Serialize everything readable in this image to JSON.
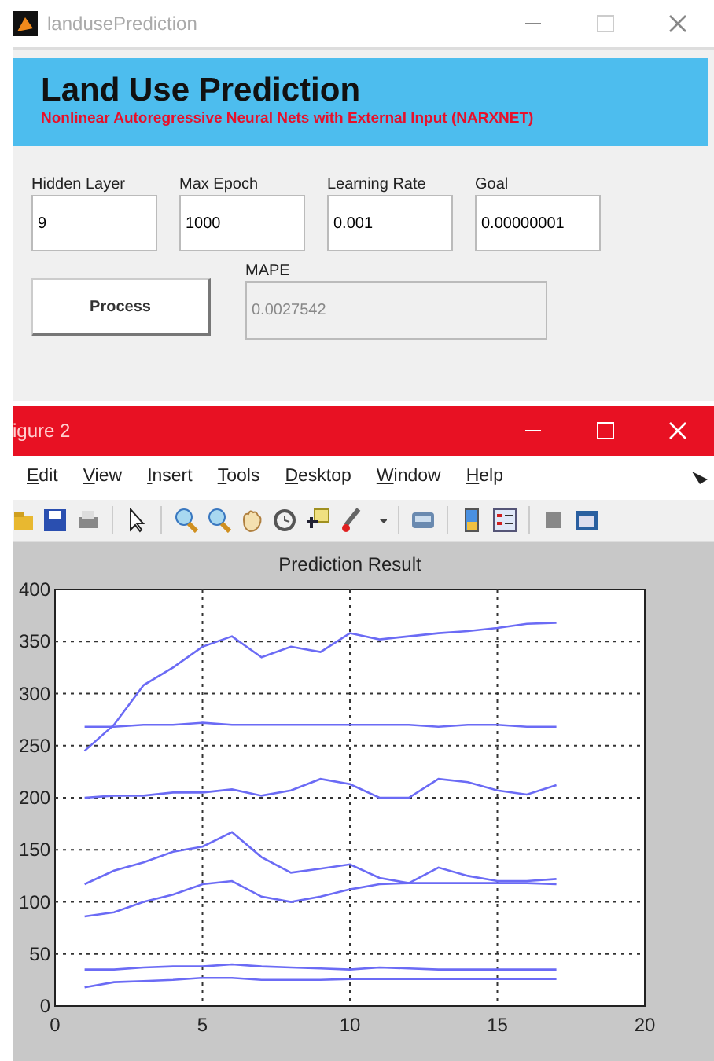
{
  "app_window": {
    "title": "landusePrediction",
    "banner": {
      "title": "Land Use Prediction",
      "subtitle": "Nonlinear Autoregressive Neural Nets with External Input (NARXNET)"
    },
    "fields": [
      {
        "label": "Hidden Layer",
        "value": "9"
      },
      {
        "label": "Max Epoch",
        "value": "1000"
      },
      {
        "label": "Learning Rate",
        "value": "0.001"
      },
      {
        "label": "Goal",
        "value": "0.00000001"
      }
    ],
    "process_button": "Process",
    "mape": {
      "label": "MAPE",
      "value": "0.0027542",
      "disabled": true
    }
  },
  "figure_window": {
    "title": "igure 2",
    "menu": [
      "Edit",
      "View",
      "Insert",
      "Tools",
      "Desktop",
      "Window",
      "Help"
    ],
    "chart_data": {
      "type": "line",
      "grid": true,
      "title": "Prediction Result",
      "x": [
        1,
        2,
        3,
        4,
        5,
        6,
        7,
        8,
        9,
        10,
        11,
        12,
        13,
        14,
        15,
        16,
        17
      ],
      "xlim": [
        0,
        20
      ],
      "ylim": [
        0,
        400
      ],
      "xticks": [
        0,
        5,
        10,
        15,
        20
      ],
      "yticks": [
        0,
        50,
        100,
        150,
        200,
        250,
        300,
        350,
        400
      ],
      "series": [
        {
          "color": "#6b6bf5",
          "values": [
            245,
            270,
            308,
            325,
            345,
            355,
            335,
            345,
            340,
            358,
            352,
            355,
            358,
            360,
            363,
            367,
            368
          ]
        },
        {
          "color": "#6b6bf5",
          "values": [
            268,
            268,
            270,
            270,
            272,
            270,
            270,
            270,
            270,
            270,
            270,
            270,
            268,
            270,
            270,
            268,
            268
          ]
        },
        {
          "color": "#6b6bf5",
          "values": [
            200,
            202,
            202,
            205,
            205,
            208,
            202,
            207,
            218,
            213,
            200,
            200,
            218,
            215,
            207,
            203,
            212
          ]
        },
        {
          "color": "#6b6bf5",
          "values": [
            117,
            130,
            138,
            148,
            153,
            167,
            143,
            128,
            132,
            136,
            123,
            118,
            133,
            125,
            120,
            120,
            122
          ]
        },
        {
          "color": "#6b6bf5",
          "values": [
            86,
            90,
            100,
            107,
            117,
            120,
            105,
            100,
            105,
            112,
            117,
            118,
            118,
            118,
            118,
            118,
            117
          ]
        },
        {
          "color": "#6b6bf5",
          "values": [
            35,
            35,
            37,
            38,
            38,
            40,
            38,
            37,
            36,
            35,
            37,
            36,
            35,
            35,
            35,
            35,
            35
          ]
        },
        {
          "color": "#6b6bf5",
          "values": [
            18,
            23,
            24,
            25,
            27,
            27,
            25,
            25,
            25,
            26,
            26,
            26,
            26,
            26,
            26,
            26,
            26
          ]
        }
      ]
    }
  }
}
